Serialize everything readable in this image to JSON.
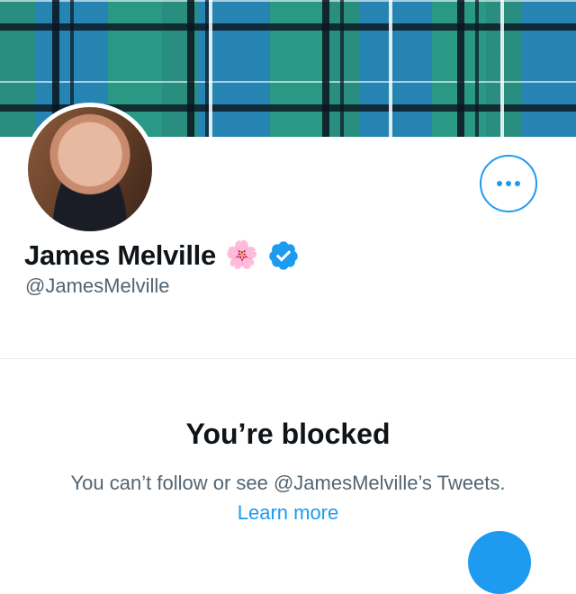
{
  "profile": {
    "name": "James Melville",
    "flower_emoji": "🌸",
    "handle": "@JamesMelville",
    "verified": true
  },
  "actions": {
    "more_icon": "more-horizontal-icon"
  },
  "blocked": {
    "title": "You’re blocked",
    "message": "You can’t follow or see @JamesMelville’s Tweets.",
    "link_label": "Learn more"
  },
  "colors": {
    "accent": "#1d9bf0",
    "text_primary": "#0f1419",
    "text_secondary": "#536471"
  }
}
